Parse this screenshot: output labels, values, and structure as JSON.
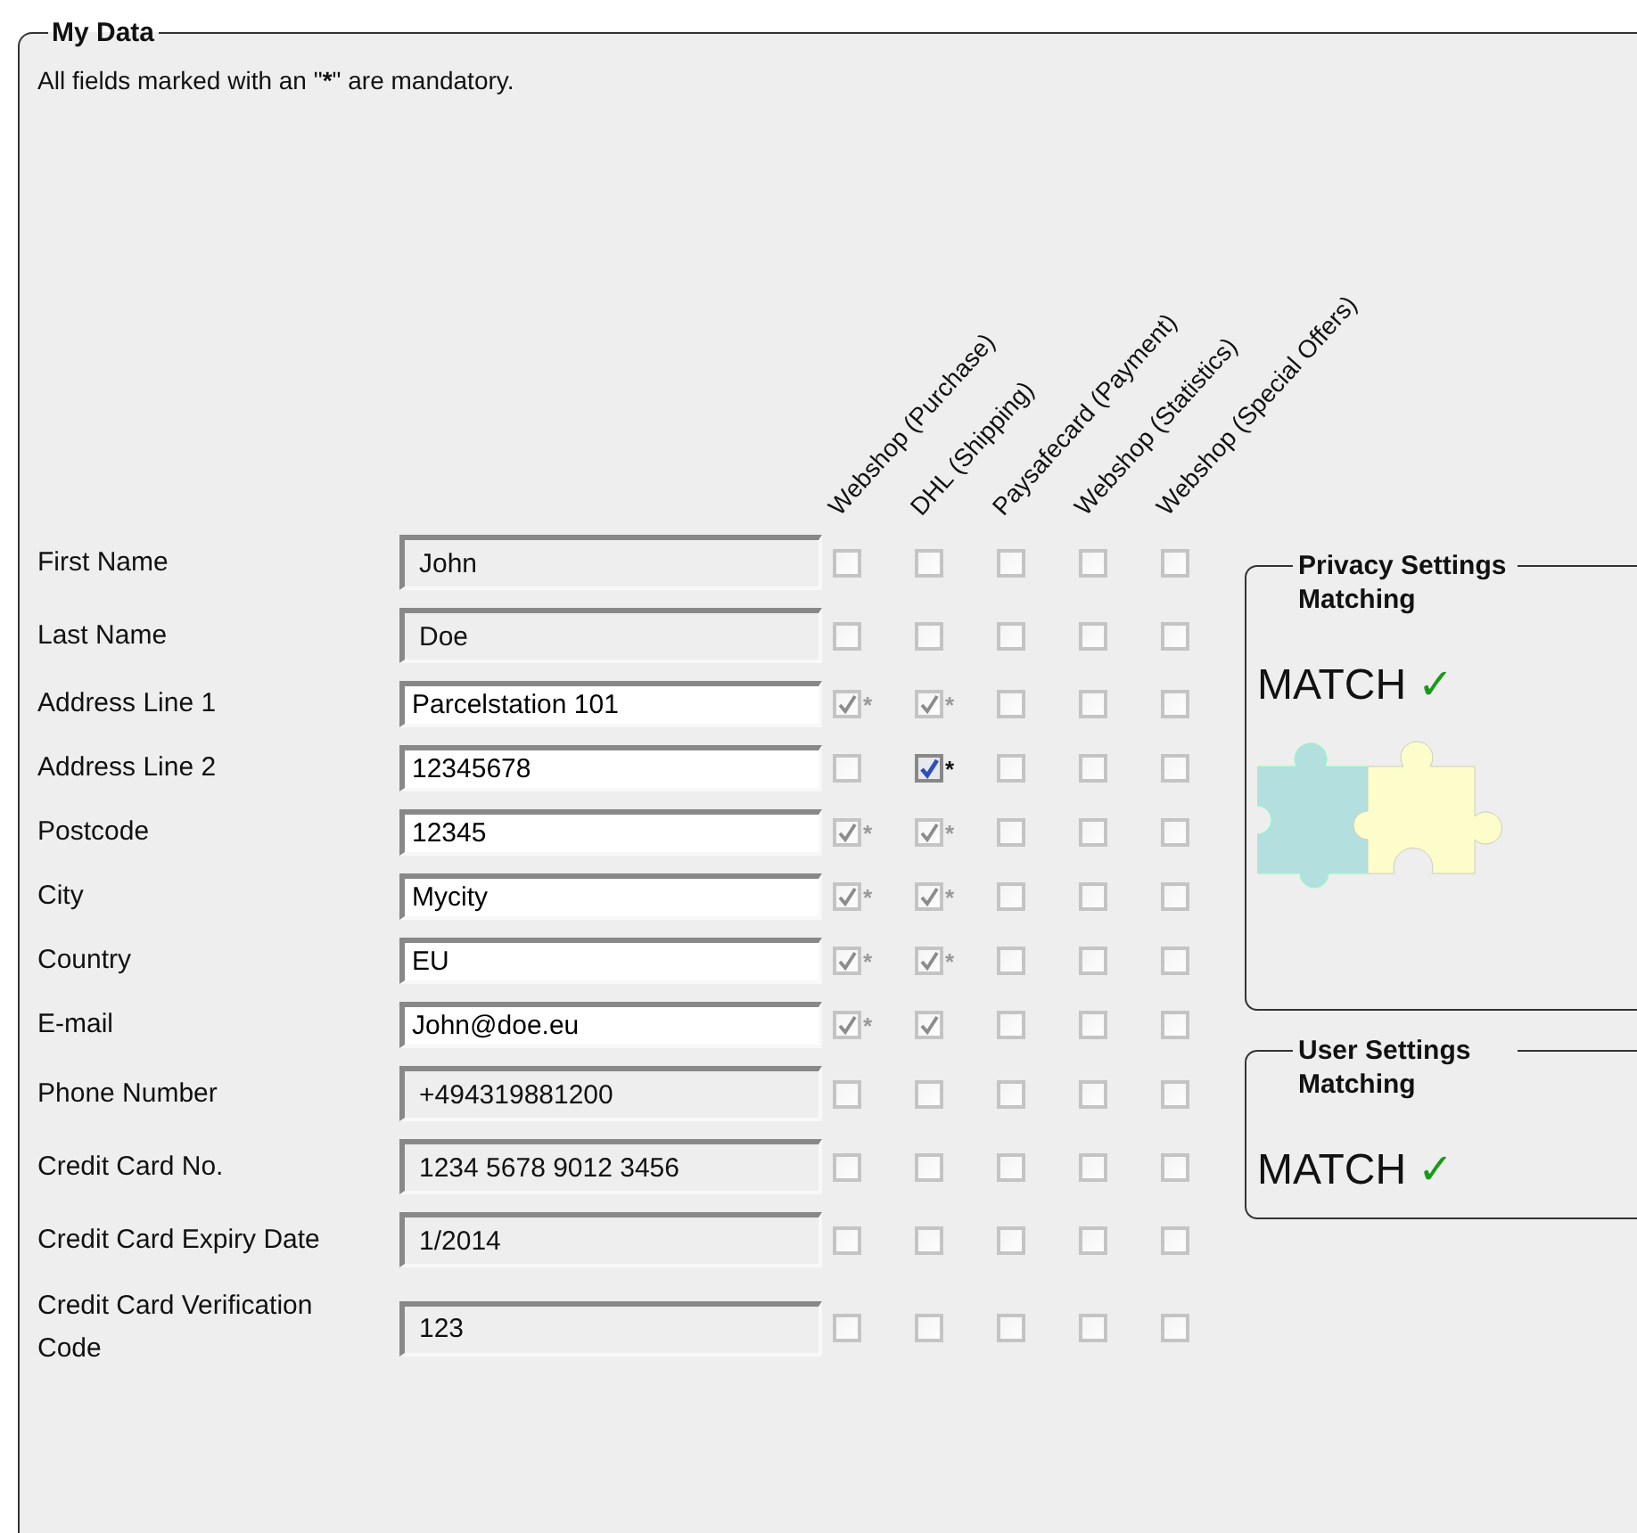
{
  "frame": {
    "title": "My Data",
    "intro": {
      "before": "All fields marked with an \"",
      "mark": "*",
      "after": "\" are mandatory."
    }
  },
  "columns": [
    "Webshop (Purchase)",
    "DHL (Shipping)",
    "Paysafecard (Payment)",
    "Webshop (Statistics)",
    "Webshop (Special Offers)"
  ],
  "rows": [
    {
      "label": "First Name",
      "value": "John",
      "disabled": true,
      "cells": [
        {
          "checked": false,
          "disabled": true
        },
        {
          "checked": false,
          "disabled": true
        },
        {
          "checked": false,
          "disabled": true
        },
        {
          "checked": false,
          "disabled": true
        },
        {
          "checked": false,
          "disabled": true
        }
      ]
    },
    {
      "label": "Last Name",
      "value": "Doe",
      "disabled": true,
      "cells": [
        {
          "checked": false,
          "disabled": true
        },
        {
          "checked": false,
          "disabled": true
        },
        {
          "checked": false,
          "disabled": true
        },
        {
          "checked": false,
          "disabled": true
        },
        {
          "checked": false,
          "disabled": true
        }
      ]
    },
    {
      "label": "Address Line 1",
      "value": "Parcelstation 101",
      "disabled": false,
      "cells": [
        {
          "checked": true,
          "disabled": true,
          "note": "*"
        },
        {
          "checked": true,
          "disabled": true,
          "note": "*"
        },
        {
          "checked": false,
          "disabled": true
        },
        {
          "checked": false,
          "disabled": true
        },
        {
          "checked": false,
          "disabled": true
        }
      ]
    },
    {
      "label": "Address Line 2",
      "value": "12345678",
      "disabled": false,
      "cells": [
        {
          "checked": false,
          "disabled": true
        },
        {
          "checked": true,
          "disabled": false,
          "note": "*"
        },
        {
          "checked": false,
          "disabled": true
        },
        {
          "checked": false,
          "disabled": true
        },
        {
          "checked": false,
          "disabled": true
        }
      ]
    },
    {
      "label": "Postcode",
      "value": "12345",
      "disabled": false,
      "cells": [
        {
          "checked": true,
          "disabled": true,
          "note": "*"
        },
        {
          "checked": true,
          "disabled": true,
          "note": "*"
        },
        {
          "checked": false,
          "disabled": true
        },
        {
          "checked": false,
          "disabled": true
        },
        {
          "checked": false,
          "disabled": true
        }
      ]
    },
    {
      "label": "City",
      "value": "Mycity",
      "disabled": false,
      "cells": [
        {
          "checked": true,
          "disabled": true,
          "note": "*"
        },
        {
          "checked": true,
          "disabled": true,
          "note": "*"
        },
        {
          "checked": false,
          "disabled": true
        },
        {
          "checked": false,
          "disabled": true
        },
        {
          "checked": false,
          "disabled": true
        }
      ]
    },
    {
      "label": "Country",
      "value": "EU",
      "disabled": false,
      "cells": [
        {
          "checked": true,
          "disabled": true,
          "note": "*"
        },
        {
          "checked": true,
          "disabled": true,
          "note": "*"
        },
        {
          "checked": false,
          "disabled": true
        },
        {
          "checked": false,
          "disabled": true
        },
        {
          "checked": false,
          "disabled": true
        }
      ]
    },
    {
      "label": "E-mail",
      "value": "John@doe.eu",
      "disabled": false,
      "cells": [
        {
          "checked": true,
          "disabled": true,
          "note": "*"
        },
        {
          "checked": true,
          "disabled": true
        },
        {
          "checked": false,
          "disabled": true
        },
        {
          "checked": false,
          "disabled": true
        },
        {
          "checked": false,
          "disabled": true
        }
      ]
    },
    {
      "label": "Phone Number",
      "value": "+494319881200",
      "disabled": true,
      "cells": [
        {
          "checked": false,
          "disabled": true
        },
        {
          "checked": false,
          "disabled": true
        },
        {
          "checked": false,
          "disabled": true
        },
        {
          "checked": false,
          "disabled": true
        },
        {
          "checked": false,
          "disabled": true
        }
      ]
    },
    {
      "label": "Credit Card No.",
      "value": "1234 5678 9012 3456",
      "disabled": true,
      "cells": [
        {
          "checked": false,
          "disabled": true
        },
        {
          "checked": false,
          "disabled": true
        },
        {
          "checked": false,
          "disabled": true
        },
        {
          "checked": false,
          "disabled": true
        },
        {
          "checked": false,
          "disabled": true
        }
      ]
    },
    {
      "label": "Credit Card Expiry Date",
      "value": "1/2014",
      "disabled": true,
      "cells": [
        {
          "checked": false,
          "disabled": true
        },
        {
          "checked": false,
          "disabled": true
        },
        {
          "checked": false,
          "disabled": true
        },
        {
          "checked": false,
          "disabled": true
        },
        {
          "checked": false,
          "disabled": true
        }
      ]
    },
    {
      "label": "Credit Card Verification Code",
      "value": "123",
      "disabled": true,
      "cells": [
        {
          "checked": false,
          "disabled": true
        },
        {
          "checked": false,
          "disabled": true
        },
        {
          "checked": false,
          "disabled": true
        },
        {
          "checked": false,
          "disabled": true
        },
        {
          "checked": false,
          "disabled": true
        }
      ]
    }
  ],
  "panels": [
    {
      "title": "Privacy Settings Matching",
      "status": "MATCH",
      "mark": "✓",
      "kind": "puzzle"
    },
    {
      "title": "User Settings Matching",
      "status": "MATCH",
      "mark": "✓",
      "kind": "plain"
    }
  ]
}
